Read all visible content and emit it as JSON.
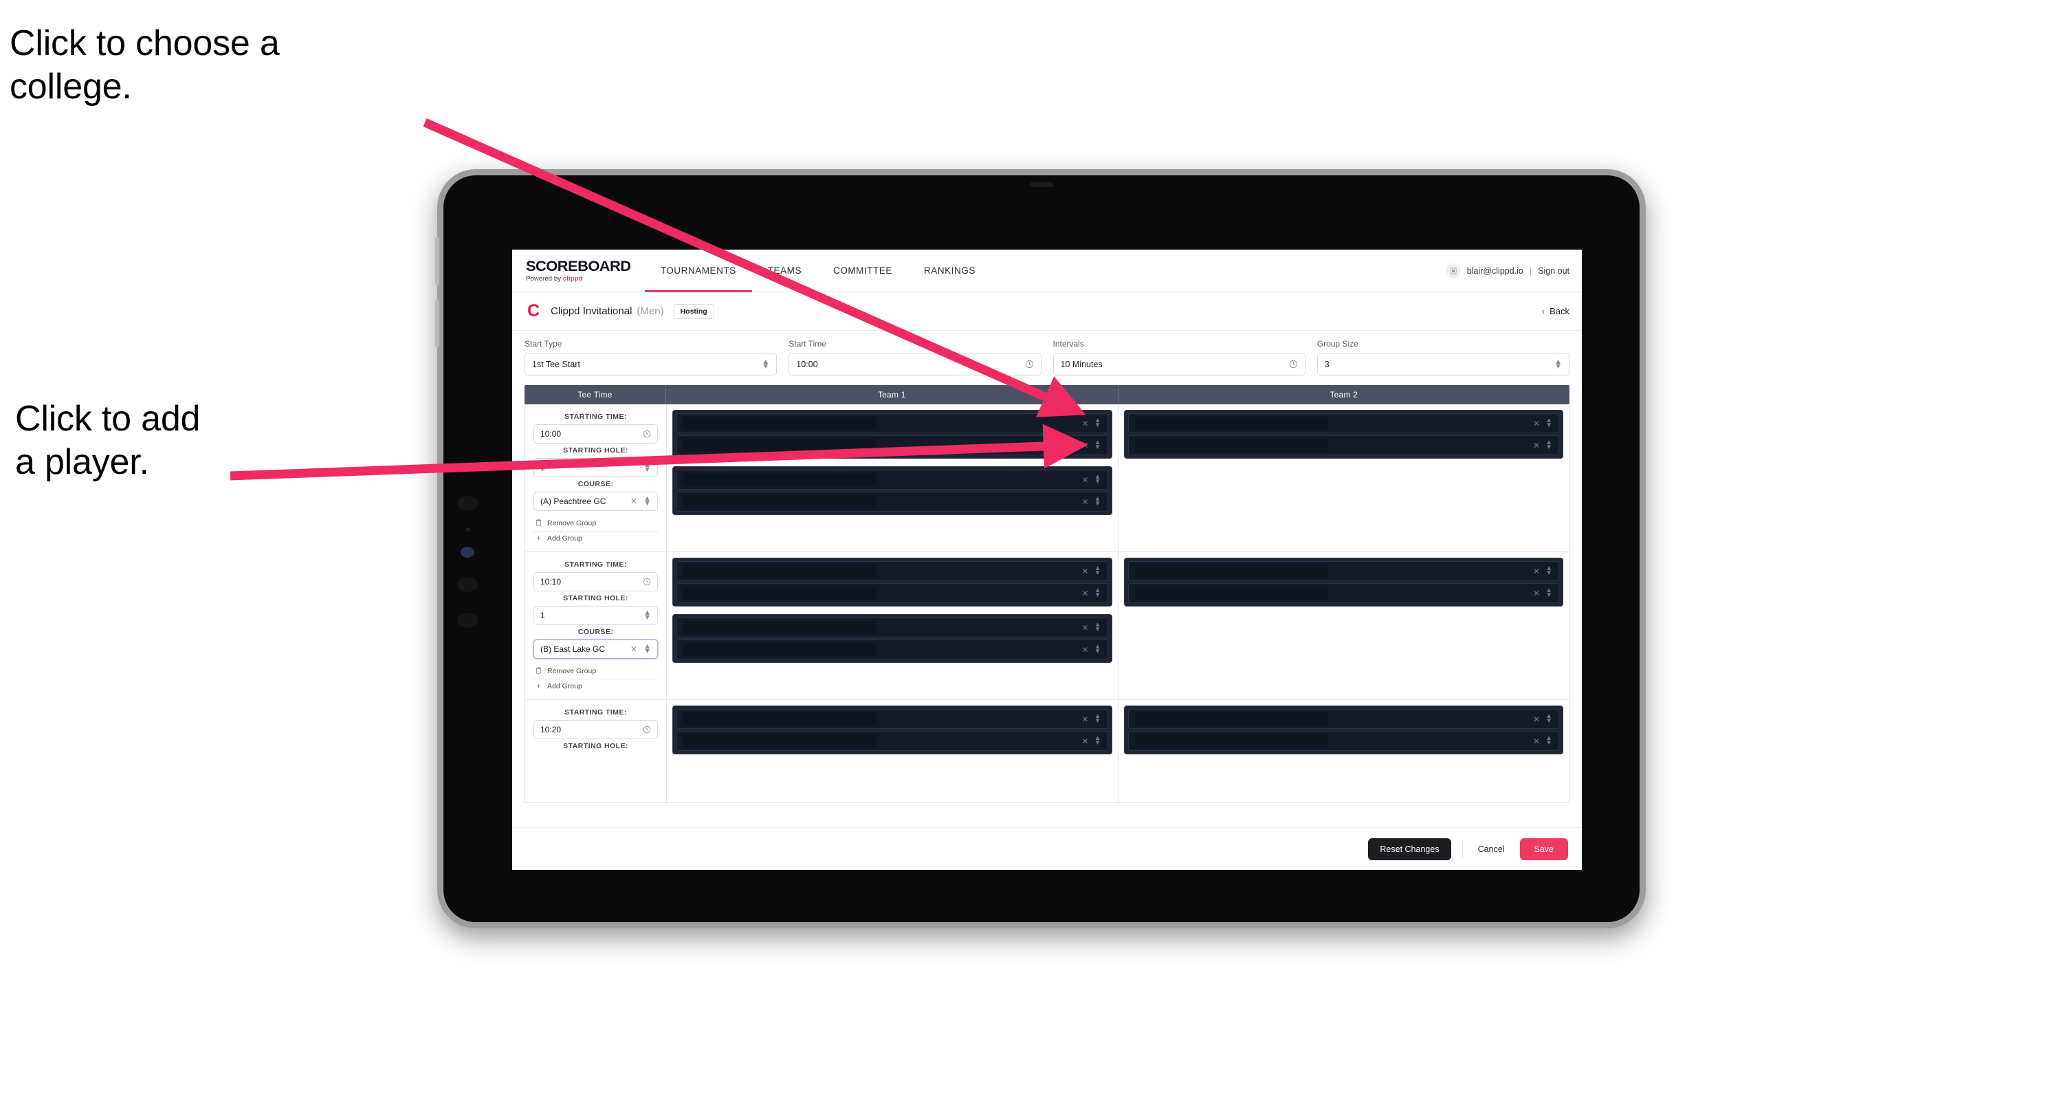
{
  "annotations": {
    "college": "Click to choose a\ncollege.",
    "player": "Click to add\na player."
  },
  "colors": {
    "accent_pink": "#ef3a63",
    "arrow_pink": "#ef2b63",
    "nav_underline": "#d93a5e",
    "table_header": "#4c5264",
    "redacted_block": "#1f2533",
    "redacted_row": "#141a27"
  },
  "topnav": {
    "brand_word": "SCOREBOARD",
    "brand_sub_prefix": "Powered by ",
    "brand_sub_name": "clippd",
    "tabs": [
      {
        "label": "TOURNAMENTS",
        "active": true
      },
      {
        "label": "TEAMS",
        "active": false
      },
      {
        "label": "COMMITTEE",
        "active": false
      },
      {
        "label": "RANKINGS",
        "active": false
      }
    ],
    "avatar_icon": "user-avatar-icon",
    "user_email": "blair@clippd.io",
    "separator": "|",
    "sign_out": "Sign out"
  },
  "tournament_bar": {
    "logo_letter": "C",
    "name": "Clippd Invitational",
    "gender": "(Men)",
    "badge": "Hosting",
    "back_chevron": "‹",
    "back_label": "Back"
  },
  "settings": {
    "fields": [
      {
        "label": "Start Type",
        "value": "1st Tee Start",
        "icon": "stepper-icon"
      },
      {
        "label": "Start Time",
        "value": "10:00",
        "icon": "clock-icon"
      },
      {
        "label": "Intervals",
        "value": "10 Minutes",
        "icon": "clock-icon"
      },
      {
        "label": "Group Size",
        "value": "3",
        "icon": "stepper-icon"
      }
    ]
  },
  "table": {
    "headers": [
      "Tee Time",
      "Team 1",
      "Team 2"
    ],
    "labels": {
      "starting_time": "STARTING TIME:",
      "starting_hole": "STARTING HOLE:",
      "course": "COURSE:",
      "remove_group": "Remove Group",
      "add_group": "Add Group",
      "remove_icon": "trash-icon",
      "add_icon": "plus-icon",
      "clear_icon": "close-x-icon",
      "stepper_icon": "stepper-updown-icon",
      "clock_icon": "clock-icon"
    },
    "rows": [
      {
        "starting_time": "10:00",
        "starting_hole": "1",
        "course": "(A) Peachtree GC",
        "course_focused": false,
        "team1_groups": [
          {
            "players": 2
          },
          {
            "players": 2
          }
        ],
        "team2_groups": [
          {
            "players": 2
          }
        ]
      },
      {
        "starting_time": "10:10",
        "starting_hole": "1",
        "course": "(B) East Lake GC",
        "course_focused": true,
        "team1_groups": [
          {
            "players": 2
          },
          {
            "players": 2
          }
        ],
        "team2_groups": [
          {
            "players": 2
          }
        ]
      },
      {
        "starting_time": "10:20",
        "starting_hole": "",
        "course": "",
        "course_focused": false,
        "team1_groups": [
          {
            "players": 2
          }
        ],
        "team2_groups": [
          {
            "players": 2
          }
        ]
      }
    ]
  },
  "footer": {
    "reset_label": "Reset Changes",
    "cancel_label": "Cancel",
    "save_label": "Save"
  }
}
